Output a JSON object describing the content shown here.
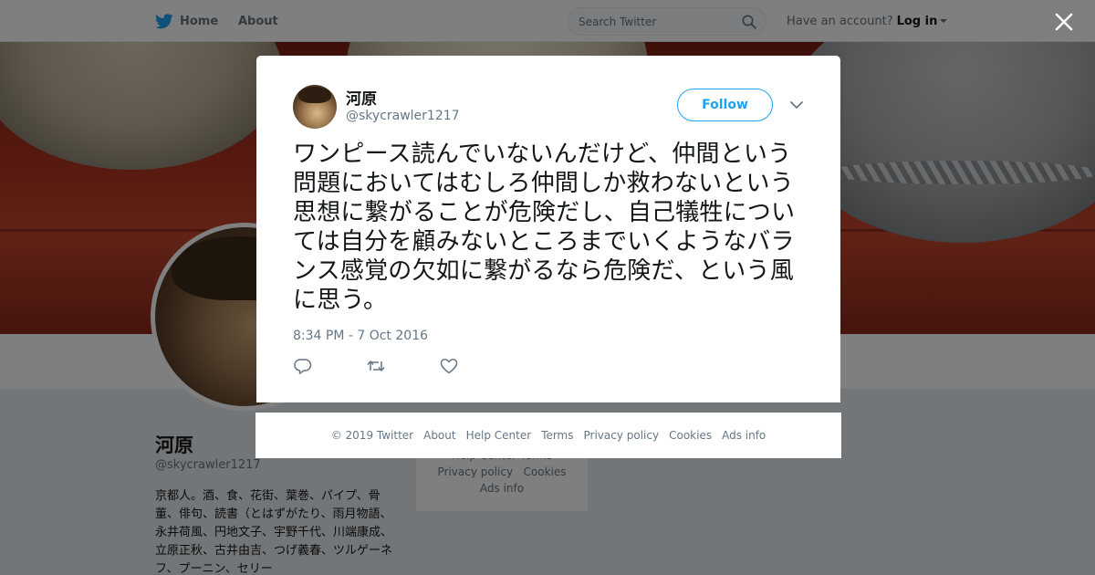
{
  "nav": {
    "home_label": "Home",
    "about_label": "About",
    "search_placeholder": "Search Twitter",
    "account_prompt": "Have an account?",
    "login_label": "Log in",
    "brand_color": "#1da1f2"
  },
  "profile": {
    "name": "河原",
    "handle": "@skycrawler1217",
    "bio": "京都人。酒、食、花街、葉巻、パイプ、骨董、俳句、読書（とはずがたり、雨月物語、永井荷風、円地文子、宇野千代、川端康成、立原正秋、古井由吉、つげ義春、ツルゲーネフ、プーニン、セリー"
  },
  "side_footer": {
    "line1": "Help Center   Terms",
    "privacy": "Privacy policy",
    "cookies": "Cookies",
    "ads": "Ads info"
  },
  "tweet": {
    "author_name": "河原",
    "author_handle": "@skycrawler1217",
    "follow_label": "Follow",
    "text": "ワンピース読んでいないんだけど、仲間という問題においてはむしろ仲間しか救わないという思想に繋がることが危険だし、自己犠牲については自分を顧みないところまでいくようなバランス感覚の欠如に繋がるなら危険だ、という風に思う。",
    "timestamp": "8:34 PM - 7 Oct 2016",
    "actions": {
      "reply_icon": "reply-icon",
      "retweet_icon": "retweet-icon",
      "like_icon": "heart-icon"
    }
  },
  "footer": {
    "copyright": "© 2019 Twitter",
    "about": "About",
    "help": "Help Center",
    "terms": "Terms",
    "privacy": "Privacy policy",
    "cookies": "Cookies",
    "ads": "Ads info"
  }
}
